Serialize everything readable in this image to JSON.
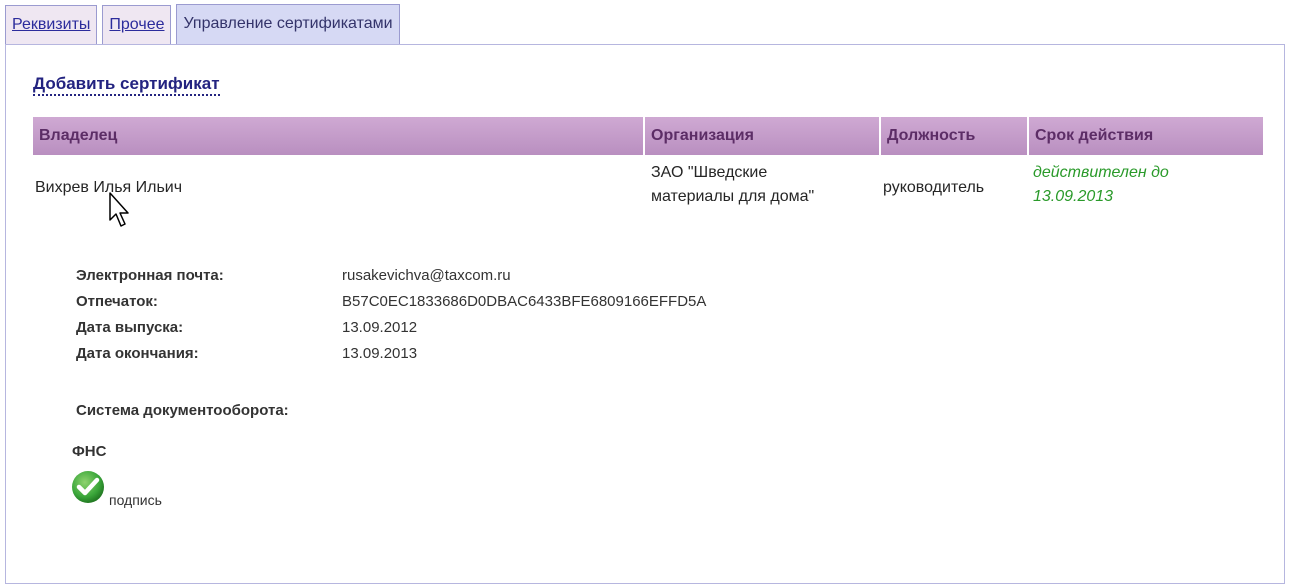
{
  "tabs": [
    {
      "label": "Реквизиты",
      "active": false
    },
    {
      "label": "Прочее",
      "active": false
    },
    {
      "label": "Управление сертификатами",
      "active": true
    }
  ],
  "add_certificate_label": "Добавить сертификат",
  "table": {
    "headers": [
      "Владелец",
      "Организация",
      "Должность",
      "Срок действия"
    ],
    "rows": [
      {
        "owner": "Вихрев Илья Ильич",
        "organization_line1": "ЗАО \"Шведские",
        "organization_line2": "материалы для дома\"",
        "position": "руководитель",
        "validity_line1": "действителен до",
        "validity_line2": "13.09.2013"
      }
    ]
  },
  "details": [
    {
      "label": "Электронная почта:",
      "value": "rusakevichva@taxcom.ru"
    },
    {
      "label": "Отпечаток:",
      "value": "B57C0EC1833686D0DBAC6433BFE6809166EFFD5A"
    },
    {
      "label": "Дата выпуска:",
      "value": "13.09.2012"
    },
    {
      "label": "Дата окончания:",
      "value": "13.09.2013"
    }
  ],
  "system_label": "Система документооборота:",
  "system_name": "ФНС",
  "signature_label": "подпись",
  "colors": {
    "header_bg": "#c39bc9",
    "valid_text": "#2a9a2a",
    "link": "#232380",
    "check": "#3aa63a"
  }
}
